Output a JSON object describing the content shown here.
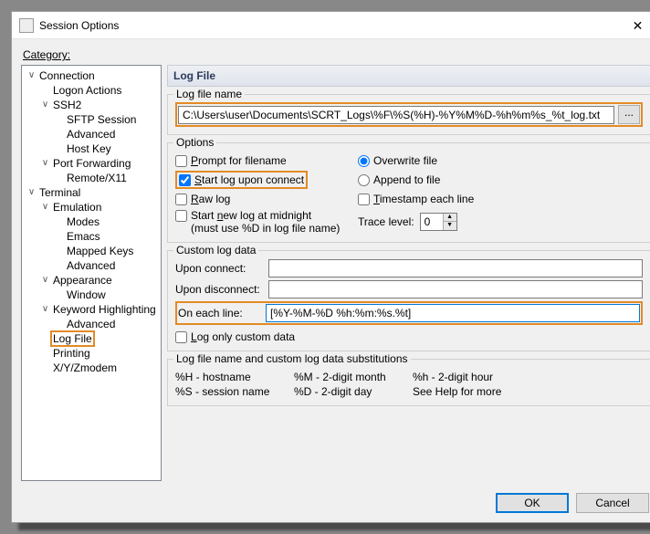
{
  "window": {
    "title": "Session Options",
    "close": "✕"
  },
  "category_label": "Category:",
  "tree": {
    "connection": "Connection",
    "logon_actions": "Logon Actions",
    "ssh2": "SSH2",
    "sftp_session": "SFTP Session",
    "advanced": "Advanced",
    "host_key": "Host Key",
    "port_forwarding": "Port Forwarding",
    "remote_x11": "Remote/X11",
    "terminal": "Terminal",
    "emulation": "Emulation",
    "modes": "Modes",
    "emacs": "Emacs",
    "mapped_keys": "Mapped Keys",
    "appearance": "Appearance",
    "window_item": "Window",
    "keyword_highlighting": "Keyword Highlighting",
    "log_file": "Log File",
    "printing": "Printing",
    "xyzmodem": "X/Y/Zmodem"
  },
  "panel": {
    "title": "Log File"
  },
  "logfilename": {
    "group_title": "Log file name",
    "value": "C:\\Users\\user\\Documents\\SCRT_Logs\\%F\\%S(%H)-%Y%M%D-%h%m%s_%t_log.txt",
    "browse": "..."
  },
  "options": {
    "group_title": "Options",
    "prompt": "Prompt for filename",
    "start_upon_connect": "Start log upon connect",
    "raw": "Raw log",
    "start_midnight_l1": "Start new log at midnight",
    "start_midnight_l2": "(must use %D in log file name)",
    "overwrite": "Overwrite file",
    "append": "Append to file",
    "timestamp": "Timestamp each line",
    "trace_label": "Trace level:",
    "trace_value": "0"
  },
  "custom": {
    "group_title": "Custom log data",
    "upon_connect": "Upon connect:",
    "upon_disconnect": "Upon disconnect:",
    "on_each_line": "On each line:",
    "on_each_line_value": "[%Y-%M-%D %h:%m:%s.%t] ",
    "log_only": "Log only custom data"
  },
  "subs": {
    "group_title": "Log file name and custom log data substitutions",
    "h_upper": "%H - hostname",
    "m_upper": "%M - 2-digit month",
    "h_lower": "%h - 2-digit hour",
    "s_upper": "%S - session name",
    "d_upper": "%D - 2-digit day",
    "see_help": "See Help for more"
  },
  "buttons": {
    "ok": "OK",
    "cancel": "Cancel"
  }
}
